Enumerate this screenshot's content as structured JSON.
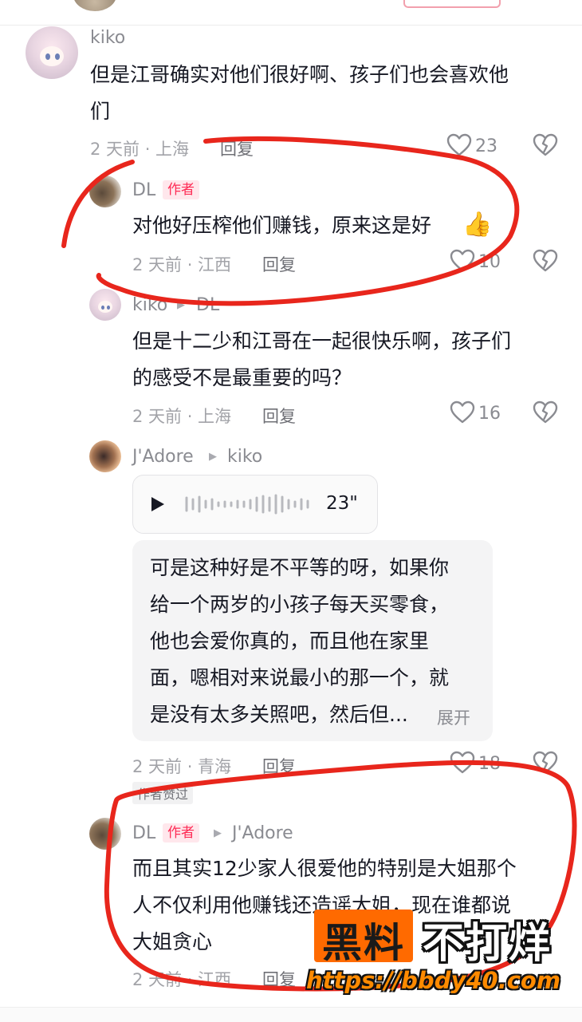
{
  "comments": [
    {
      "user": "kiko",
      "text_lines": [
        "但是江哥确实对他们很好啊、孩子们也会喜欢他",
        "们"
      ],
      "meta": "2 天前 · 上海",
      "reply_label": "回复",
      "likes": "23",
      "replies": [
        {
          "user": "DL",
          "author_badge": "作者",
          "text": "对他好压榨他们赚钱，原来这是好",
          "emoji": "👍",
          "meta": "2 天前 · 江西",
          "reply_label": "回复",
          "likes": "10"
        },
        {
          "user": "kiko",
          "reply_to": "DL",
          "text_lines": [
            "但是十二少和江哥在一起很快乐啊，孩子们",
            "的感受不是最重要的吗？"
          ],
          "meta": "2 天前 · 上海",
          "reply_label": "回复",
          "likes": "16"
        },
        {
          "user": "J'Adore",
          "reply_to": "kiko",
          "voice_duration": "23\"",
          "text_lines": [
            "可是这种好是不平等的呀，如果你",
            "给一个两岁的小孩子每天买零食，",
            "他也会爱你真的，而且他在家里",
            "面，嗯相对来说最小的那一个，就",
            "是没有太多关照吧，然后但..."
          ],
          "expand_label": "展开",
          "meta": "2 天前 · 青海",
          "reply_label": "回复",
          "likes": "18",
          "tag": "作者赞过"
        },
        {
          "user": "DL",
          "author_badge": "作者",
          "reply_to": "J'Adore",
          "text_lines": [
            "而且其实12少家人很爱他的特别是大姐那个",
            "人不仅利用他赚钱还造谣大姐，现在谁都说",
            "大姐贪心"
          ],
          "meta": "2 天前 · 江西",
          "reply_label": "回复"
        }
      ]
    }
  ],
  "watermark": {
    "title_a": "黑料",
    "title_b": "不打烊",
    "url": "https://bbdy40.com"
  },
  "icons": [
    "heart-icon",
    "dislike-heart-icon",
    "play-icon",
    "waveform-icon",
    "thumbs-up-icon"
  ],
  "colors": {
    "accent": "#fe2c55",
    "annotation": "#e8261c",
    "watermark": "#ff6a00"
  }
}
